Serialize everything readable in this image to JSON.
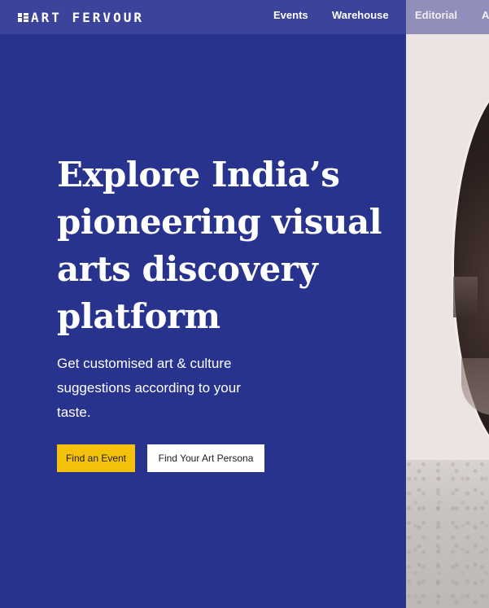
{
  "brand": {
    "logo_text": "ART FERVOUR"
  },
  "nav": {
    "items": [
      {
        "label": "Events"
      },
      {
        "label": "Warehouse"
      },
      {
        "label": "Editorial"
      },
      {
        "label": "A"
      }
    ]
  },
  "hero": {
    "title": "Explore India’s pioneering visual arts discovery platform",
    "subtitle": "Get customised art & culture suggestions according to your taste.",
    "primary_button": "Find an Event",
    "secondary_button": "Find Your Art Persona"
  },
  "colors": {
    "background": "#28338e",
    "navbar": "#3b449a",
    "primary_button": "#f4c20d",
    "secondary_button": "#ffffff"
  }
}
